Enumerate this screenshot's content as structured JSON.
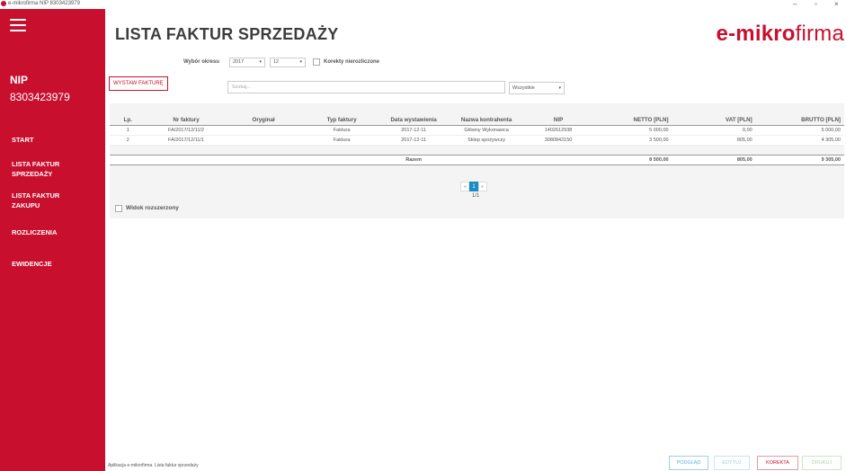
{
  "window": {
    "title": "e-mikrofirma NIP 8303423979",
    "minimize": "–",
    "maximize": "▫",
    "close": "×"
  },
  "sidebar": {
    "nip_label": "NIP",
    "nip_value": "8303423979",
    "items": [
      {
        "label": "START"
      },
      {
        "label": "LISTA FAKTUR\nSPRZEDAŻY"
      },
      {
        "label": "LISTA FAKTUR\nZAKUPU"
      },
      {
        "label": "ROZLICZENIA"
      },
      {
        "label": "EWIDENCJE"
      }
    ]
  },
  "header": {
    "page_title": "LISTA FAKTUR SPRZEDAŻY",
    "brand_bold": "e-mikro",
    "brand_light": "firma"
  },
  "filters": {
    "period_label": "Wybór okresu",
    "year": "2017",
    "month": "12",
    "corrections_label": "Korekty nierozliczone",
    "issue_button": "WYSTAW FAKTURĘ",
    "search_placeholder": "Szukaj...",
    "type_select": "Wszystkie"
  },
  "table": {
    "headers": [
      "Lp.",
      "Nr faktury",
      "Oryginał",
      "Typ faktury",
      "Data wystawienia",
      "Nazwa kontrahenta",
      "NIP",
      "NETTO [PLN]",
      "VAT [PLN]",
      "BRUTTO [PLN]"
    ],
    "rows": [
      [
        "1",
        "FA/2017/12/11/2",
        "",
        "Faktura",
        "2017-12-11",
        "Główny Wykonawca",
        "1402612938",
        "5 000,00",
        "0,00",
        "5 000,00"
      ],
      [
        "2",
        "FA/2017/12/11/1",
        "",
        "Faktura",
        "2017-12-11",
        "Sklep spożywczy",
        "3080842150",
        "3 500,00",
        "805,00",
        "4 305,00"
      ]
    ],
    "sum_label": "Razem",
    "sum_netto": "8 500,00",
    "sum_vat": "805,00",
    "sum_brutto": "9 305,00"
  },
  "pager": {
    "prev": "◂",
    "current": "1",
    "next": "▸",
    "info": "1/1"
  },
  "wide_view_label": "Widok rozszerzony",
  "status_text": "Aplikacja e-mikrofirma. Lista faktur sprzedaży",
  "bottom_buttons": {
    "preview": "PODGLĄD",
    "edit": "EDYTUJ",
    "correct": "KOREKTA",
    "print": "DRUKUJ"
  },
  "colors": {
    "accent": "#c8102e",
    "pager_active": "#1a8dc6"
  }
}
